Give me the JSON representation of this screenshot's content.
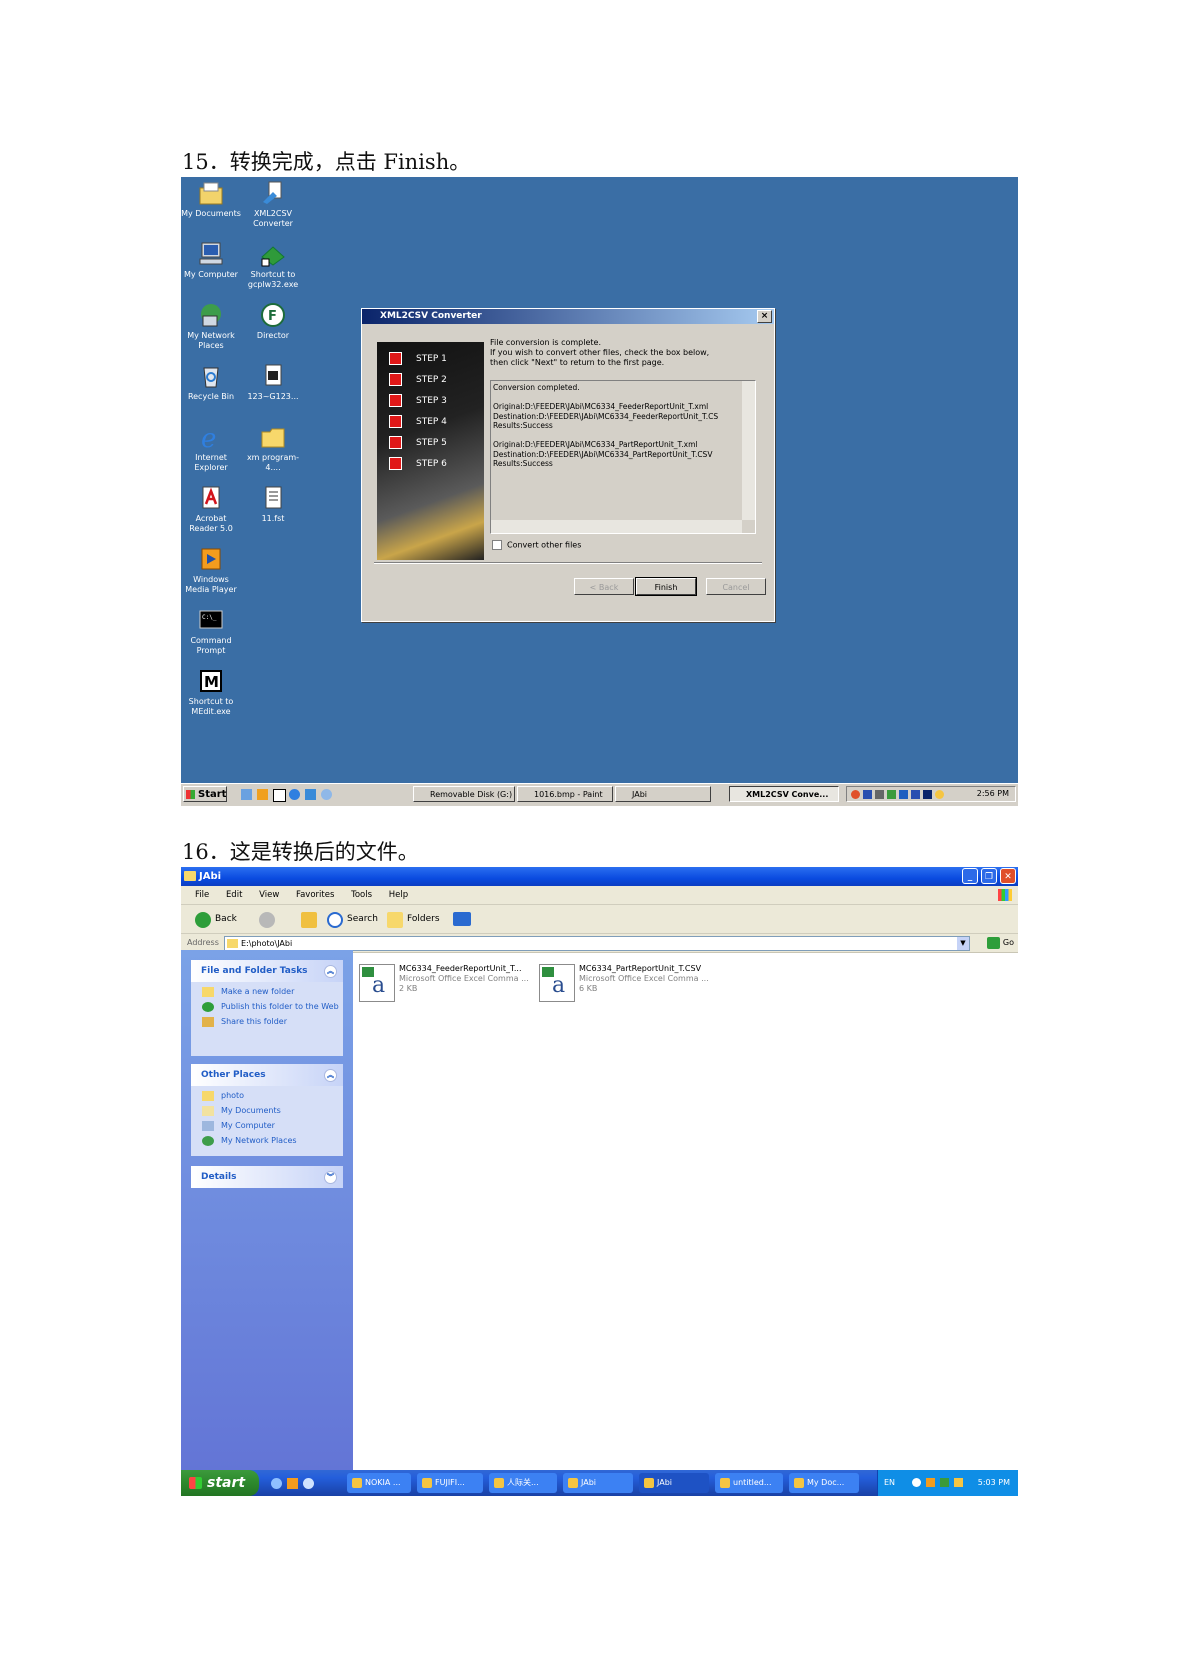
{
  "captions": {
    "step15": "15．转换完成，点击 Finish。",
    "step16": "16．这是转换后的文件。"
  },
  "desktop": {
    "background_color": "#3a6ea5",
    "icons": [
      {
        "label": "My Documents",
        "icon": "my-documents-icon"
      },
      {
        "label": "XML2CSV Converter",
        "icon": "xml2csv-icon"
      },
      {
        "label": "My Computer",
        "icon": "my-computer-icon"
      },
      {
        "label": "Shortcut to gcplw32.exe",
        "icon": "shortcut-icon"
      },
      {
        "label": "My Network Places",
        "icon": "network-places-icon"
      },
      {
        "label": "Director",
        "icon": "director-icon"
      },
      {
        "label": "Recycle Bin",
        "icon": "recycle-bin-icon"
      },
      {
        "label": "123~G123...",
        "icon": "document-icon"
      },
      {
        "label": "Internet Explorer",
        "icon": "internet-explorer-icon"
      },
      {
        "label": "xm program-4....",
        "icon": "folder-icon"
      },
      {
        "label": "Acrobat Reader 5.0",
        "icon": "acrobat-icon"
      },
      {
        "label": "11.fst",
        "icon": "text-file-icon"
      },
      {
        "label": "Windows Media Player",
        "icon": "media-player-icon"
      },
      {
        "label": "Command Prompt",
        "icon": "command-prompt-icon"
      },
      {
        "label": "Shortcut to MEdit.exe",
        "icon": "medit-icon"
      }
    ],
    "dialog": {
      "title": "XML2CSV Converter",
      "steps": [
        "STEP 1",
        "STEP 2",
        "STEP 3",
        "STEP 4",
        "STEP 5",
        "STEP 6"
      ],
      "message_line1": "File conversion is complete.",
      "message_line2": "If you wish to convert other files, check the box below,",
      "message_line3": "then click \"Next\" to return to the first page.",
      "log": [
        "Conversion completed.",
        "",
        "Original:D:\\FEEDER\\JAbi\\MC6334_FeederReportUnit_T.xml",
        "Destination:D:\\FEEDER\\JAbi\\MC6334_FeederReportUnit_T.CS",
        "Results:Success",
        "",
        "Original:D:\\FEEDER\\JAbi\\MC6334_PartReportUnit_T.xml",
        "Destination:D:\\FEEDER\\JAbi\\MC6334_PartReportUnit_T.CSV",
        "Results:Success"
      ],
      "checkbox_label": "Convert other files",
      "checkbox_checked": false,
      "back_button": "< Back",
      "finish_button": "Finish",
      "cancel_button": "Cancel"
    },
    "taskbar": {
      "start_label": "Start",
      "buttons": [
        "Removable Disk (G:)",
        "1016.bmp - Paint",
        "JAbi",
        "XML2CSV Conve..."
      ],
      "active_button": "XML2CSV Conve...",
      "clock": "2:56 PM"
    }
  },
  "explorer": {
    "window_title": "JAbi",
    "menu": [
      "File",
      "Edit",
      "View",
      "Favorites",
      "Tools",
      "Help"
    ],
    "toolbar": {
      "back": "Back",
      "search": "Search",
      "folders": "Folders"
    },
    "address_label": "Address",
    "address_value": "E:\\photo\\JAbi",
    "go_label": "Go",
    "tasks_panel": {
      "title": "File and Folder Tasks",
      "items": [
        "Make a new folder",
        "Publish this folder to the Web",
        "Share this folder"
      ]
    },
    "places_panel": {
      "title": "Other Places",
      "items": [
        "photo",
        "My Documents",
        "My Computer",
        "My Network Places"
      ]
    },
    "details_panel": {
      "title": "Details"
    },
    "files": [
      {
        "name": "MC6334_FeederReportUnit_T...",
        "type": "Microsoft Office Excel Comma ...",
        "size": "2 KB"
      },
      {
        "name": "MC6334_PartReportUnit_T.CSV",
        "type": "Microsoft Office Excel Comma ...",
        "size": "6 KB"
      }
    ],
    "taskbar": {
      "start_label": "start",
      "buttons": [
        "NOKIA ...",
        "FUJIFI...",
        "人际关...",
        "JAbi",
        "JAbi",
        "untitled...",
        "My Doc..."
      ],
      "active_index": 4,
      "language": "EN",
      "clock": "5:03 PM"
    }
  }
}
